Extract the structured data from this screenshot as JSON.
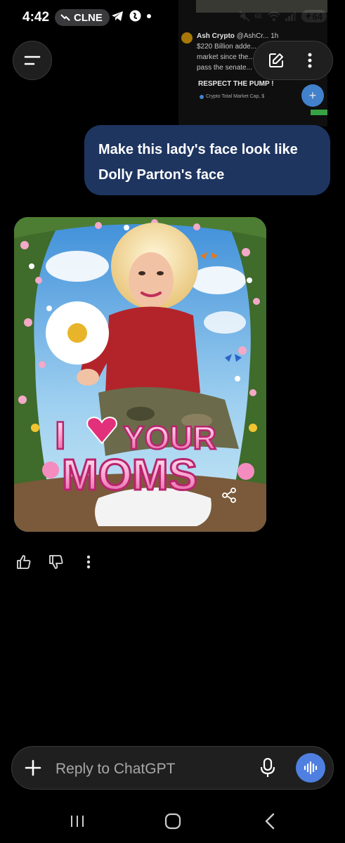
{
  "status_bar": {
    "time": "4:42",
    "carrier": "CLNE",
    "network": "6E",
    "battery": "64",
    "icons": [
      "trend-down-icon",
      "telegram-icon",
      "shazam-icon",
      "dot-icon",
      "mute-icon",
      "wifi-icon",
      "signal-icon",
      "charging-icon"
    ]
  },
  "background_app": {
    "author": "Ash Crypto",
    "handle": "@AshCr...",
    "age": "1h",
    "text_lines": [
      "$220 Billion adde...",
      "market since the...",
      "pass the senate..."
    ],
    "headline": "RESPECT THE PUMP !",
    "chart_label": "Crypto Total Market Cap, $"
  },
  "header": {
    "menu_icon": "menu-icon",
    "edit_icon": "new-chat-icon",
    "more_icon": "more-vertical-icon"
  },
  "chat": {
    "user_message": "Make this lady's face look like Dolly Parton's face",
    "image": {
      "banner_word1": "I",
      "banner_word2": "YOUR",
      "banner_word3": "MOMS",
      "share_icon": "share-icon"
    },
    "feedback": {
      "like_icon": "thumbs-up-icon",
      "dislike_icon": "thumbs-down-icon",
      "more_icon": "more-vertical-icon"
    }
  },
  "composer": {
    "placeholder": "Reply to ChatGPT",
    "plus_icon": "plus-icon",
    "mic_icon": "mic-icon",
    "voice_icon": "voice-mode-icon"
  },
  "nav": {
    "recents_icon": "recents-icon",
    "home_icon": "home-icon",
    "back_icon": "back-icon"
  },
  "colors": {
    "background": "#000000",
    "user_bubble": "#1e3560",
    "voice_button": "#4f7fe0",
    "surface": "#1f1f1f"
  }
}
